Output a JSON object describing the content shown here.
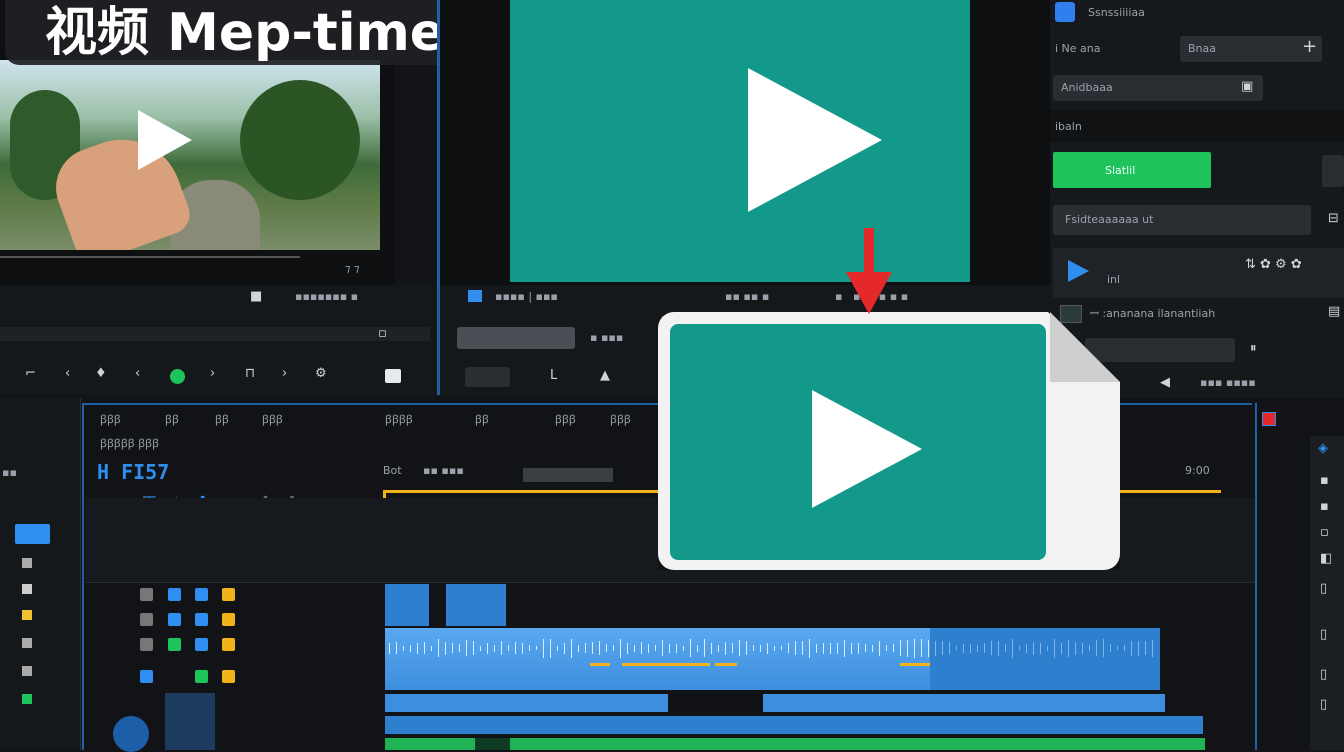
{
  "title_overlay": {
    "text": "视频 Mep-time"
  },
  "source_monitor": {
    "timecode_right": "⁊ ⁊"
  },
  "program_monitor": {
    "play_icon": "play-triangle-icon"
  },
  "right_panel": {
    "header_label": "Ssnssiiiiaa",
    "row1_left": "i Ne ana",
    "row1_dropdown": "Bnaa",
    "row2_field": "Anidbaaa",
    "row3_label": "ibaln",
    "green_button": "Slatlil",
    "field_label": "Fsidteaaaaaa ut",
    "transport_label": "inl",
    "dotted_label": "ꟷ :ananana ilanantiiah"
  },
  "timeline": {
    "timecode": "H FI57",
    "ruler_start": "Bot",
    "ruler_end": "9:00",
    "tools_row1": [
      "ꞵꞵꞵ",
      "ꞵꞵ",
      "ꞵꞵ",
      "ꞵꞵꞵ"
    ],
    "tools_row2": [
      "ꞵꞵꞵꞵ",
      "ꞵꞵ",
      "ꞵꞵꞵ",
      "ꞵꞵꞵ"
    ]
  },
  "floating_file": {
    "icon": "video-file-icon"
  },
  "colors": {
    "teal": "#13998a",
    "accent_blue": "#2f8ff0",
    "green": "#1fc35c",
    "playhead_yellow": "#f1b21a",
    "red_arrow": "#e5292b"
  }
}
